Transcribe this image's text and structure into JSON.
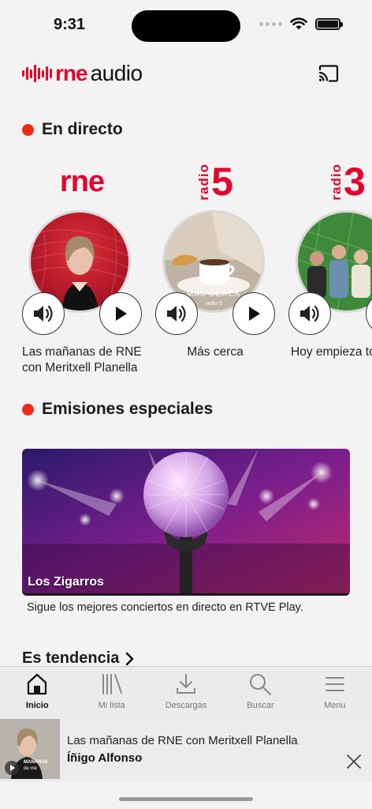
{
  "status_bar": {
    "time": "9:31"
  },
  "header": {
    "logo_brand": "rne",
    "logo_product": "audio",
    "cast_icon": "cast-icon"
  },
  "sections": {
    "live_title": "En directo",
    "special_title": "Emisiones especiales",
    "trending_title": "Es tendencia"
  },
  "live": [
    {
      "station": "rne",
      "label": "Las mañanas de RNE con Meritxell Planella"
    },
    {
      "station_prefix": "radio",
      "station_number": "5",
      "label": "Más cerca",
      "thumb_text": "MÁS CERCA",
      "thumb_subtext": "radio 5"
    },
    {
      "station_prefix": "radio",
      "station_number": "3",
      "label": "Hoy empieza todo"
    }
  ],
  "special": {
    "name": "Los Zigarros",
    "description": "Sigue los mejores conciertos en directo en RTVE Play."
  },
  "tabs": [
    {
      "label": "Inicio",
      "icon": "home-icon",
      "active": true
    },
    {
      "label": "Mi lista",
      "icon": "library-icon"
    },
    {
      "label": "Descargas",
      "icon": "download-icon"
    },
    {
      "label": "Buscar",
      "icon": "search-icon"
    },
    {
      "label": "Menu",
      "icon": "menu-icon"
    }
  ],
  "mini_player": {
    "title": "Las mañanas de RNE con Meritxell Planella",
    "subtitle": "Íñigo Alfonso",
    "thumb_text": "MAÑANAS",
    "thumb_subtext": "de rne"
  },
  "colors": {
    "brand_red": "#e4032e",
    "live_dot": "#ef2a13"
  }
}
